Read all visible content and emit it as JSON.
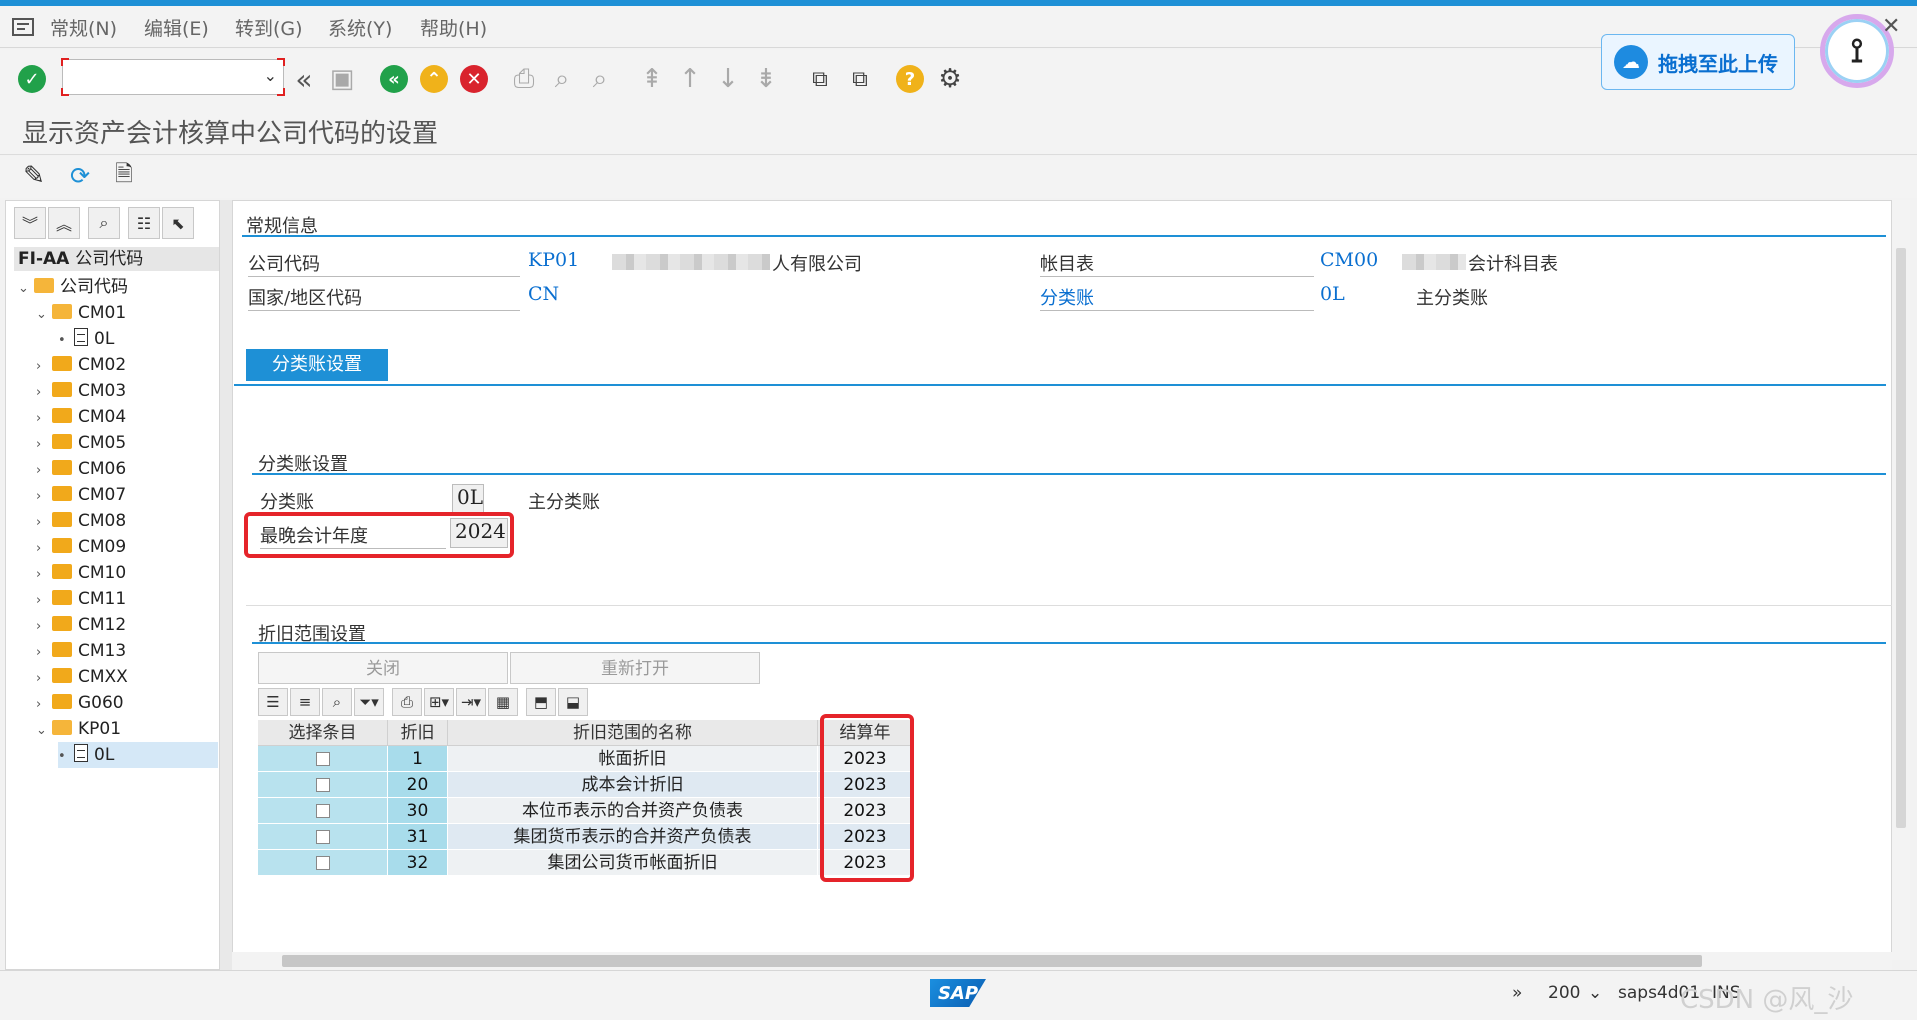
{
  "menu": {
    "items": [
      "常规(N)",
      "编辑(E)",
      "转到(G)",
      "系统(Y)",
      "帮助(H)"
    ]
  },
  "toolbar": {
    "command_placeholder": "",
    "upload_label": "拖拽至此上传"
  },
  "title": "显示资产会计核算中公司代码的设置",
  "tree": {
    "header_code": "FI-AA",
    "header_text": "公司代码",
    "root": "公司代码",
    "nodes": [
      {
        "label": "CM01",
        "expanded": true,
        "child": "0L"
      },
      {
        "label": "CM02"
      },
      {
        "label": "CM03"
      },
      {
        "label": "CM04"
      },
      {
        "label": "CM05"
      },
      {
        "label": "CM06"
      },
      {
        "label": "CM07"
      },
      {
        "label": "CM08"
      },
      {
        "label": "CM09"
      },
      {
        "label": "CM10"
      },
      {
        "label": "CM11"
      },
      {
        "label": "CM12"
      },
      {
        "label": "CM13"
      },
      {
        "label": "CMXX"
      },
      {
        "label": "G060"
      },
      {
        "label": "KP01",
        "expanded": true,
        "child": "0L"
      }
    ]
  },
  "general": {
    "group_title": "常规信息",
    "company_code_label": "公司代码",
    "company_code_value": "KP01",
    "company_name_suffix": "人有限公司",
    "country_label": "国家/地区代码",
    "country_value": "CN",
    "coa_label": "帐目表",
    "coa_value": "CM00",
    "coa_text_suffix": "会计科目表",
    "ledger_label": "分类账",
    "ledger_value": "0L",
    "ledger_text": "主分类账"
  },
  "tab": {
    "label": "分类账设置"
  },
  "ledger_settings": {
    "group_title": "分类账设置",
    "ledger_label": "分类账",
    "ledger_value": "0L",
    "ledger_text": "主分类账",
    "latest_year_label": "最晚会计年度",
    "latest_year_value": "2024"
  },
  "depr": {
    "group_title": "折旧范围设置",
    "close_button": "关闭",
    "reopen_button": "重新打开",
    "columns": [
      "选择条目",
      "折旧",
      "折旧范围的名称",
      "结算年"
    ],
    "rows": [
      {
        "key": "1",
        "name": "帐面折旧",
        "year": "2023"
      },
      {
        "key": "20",
        "name": "成本会计折旧",
        "year": "2023"
      },
      {
        "key": "30",
        "name": "本位币表示的合并资产负债表",
        "year": "2023"
      },
      {
        "key": "31",
        "name": "集团货币表示的合并资产负债表",
        "year": "2023"
      },
      {
        "key": "32",
        "name": "集团公司货币帐面折旧",
        "year": "2023"
      }
    ]
  },
  "status": {
    "client": "200",
    "system": "saps4d01",
    "mode": "INS",
    "watermark": "CSDN @风_沙"
  },
  "colors": {
    "accent": "#1e90d6",
    "highlight_red": "#e5242a",
    "key_column": "#a8dceb"
  }
}
